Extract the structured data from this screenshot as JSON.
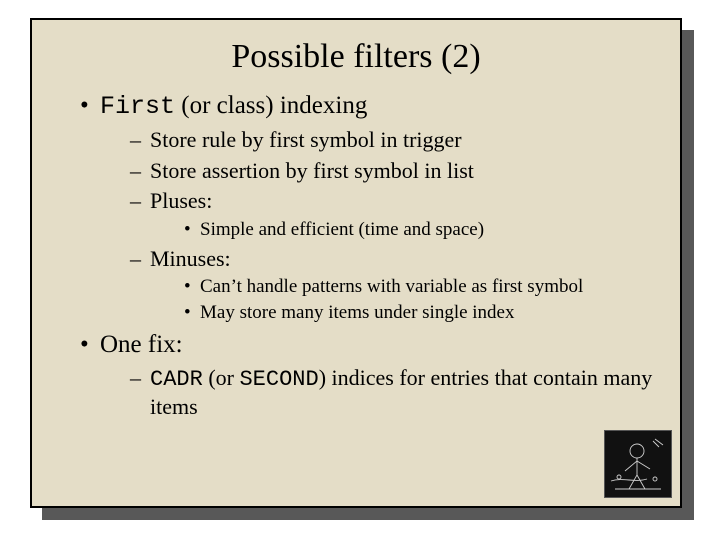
{
  "title": "Possible filters (2)",
  "bullets": {
    "b1_code": "First",
    "b1_rest": " (or class) indexing",
    "b1_sub": {
      "s1": "Store rule by first symbol in trigger",
      "s2": "Store assertion by first symbol in list",
      "s3": "Pluses:",
      "s3_sub": {
        "p1": "Simple and efficient (time and space)"
      },
      "s4": "Minuses:",
      "s4_sub": {
        "m1": "Can’t handle patterns with variable as first symbol",
        "m2": "May store many items under single index"
      }
    },
    "b2": "One fix:",
    "b2_sub": {
      "f1_code1": "CADR",
      "f1_mid": " (or ",
      "f1_code2": "SECOND",
      "f1_rest": ") indices for entries that contain many items"
    }
  }
}
